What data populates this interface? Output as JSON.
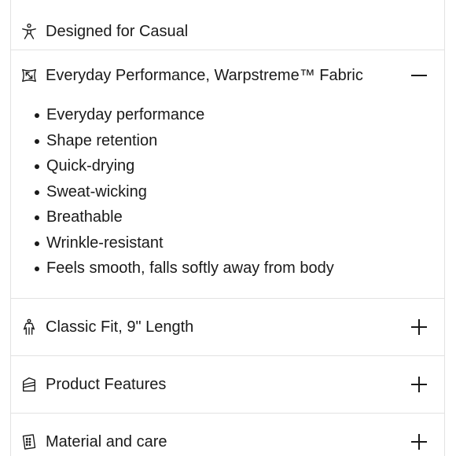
{
  "sections": [
    {
      "label": "Designed for Casual",
      "icon": "person-icon"
    },
    {
      "label": "Everyday Performance, Warpstreme™ Fabric",
      "icon": "fabric-stretch-icon",
      "state": "expanded",
      "toggle_icon": "minus-icon",
      "bullets": [
        "Everyday performance",
        "Shape retention",
        "Quick-drying",
        "Sweat-wicking",
        "Breathable",
        "Wrinkle-resistant",
        "Feels smooth, falls softly away from body"
      ]
    },
    {
      "label": "Classic Fit, 9\" Length",
      "icon": "fit-figure-icon",
      "state": "collapsed",
      "toggle_icon": "plus-icon"
    },
    {
      "label": "Product Features",
      "icon": "product-tag-icon",
      "state": "collapsed",
      "toggle_icon": "plus-icon"
    },
    {
      "label": "Material and care",
      "icon": "care-label-icon",
      "state": "collapsed",
      "toggle_icon": "plus-icon"
    }
  ],
  "colors": {
    "text": "#1a1a1a",
    "divider": "#e2e2e2",
    "background": "#ffffff"
  }
}
